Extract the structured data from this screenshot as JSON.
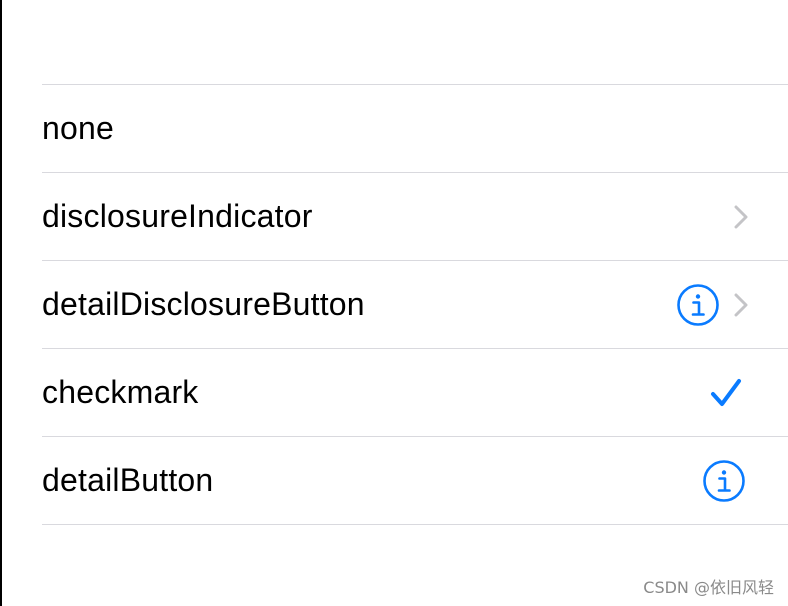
{
  "table": {
    "rows": [
      {
        "label": "none",
        "accessory": "none"
      },
      {
        "label": "disclosureIndicator",
        "accessory": "chevron-right-icon"
      },
      {
        "label": "detailDisclosureButton",
        "accessory": "info-circle-icon + chevron-right-icon"
      },
      {
        "label": "checkmark",
        "accessory": "checkmark-icon"
      },
      {
        "label": "detailButton",
        "accessory": "info-circle-icon"
      }
    ]
  },
  "colors": {
    "tint": "#0a7bff",
    "chevron": "#c4c4c7",
    "separator": "#d9d9de"
  },
  "watermark": "CSDN @依旧风轻"
}
